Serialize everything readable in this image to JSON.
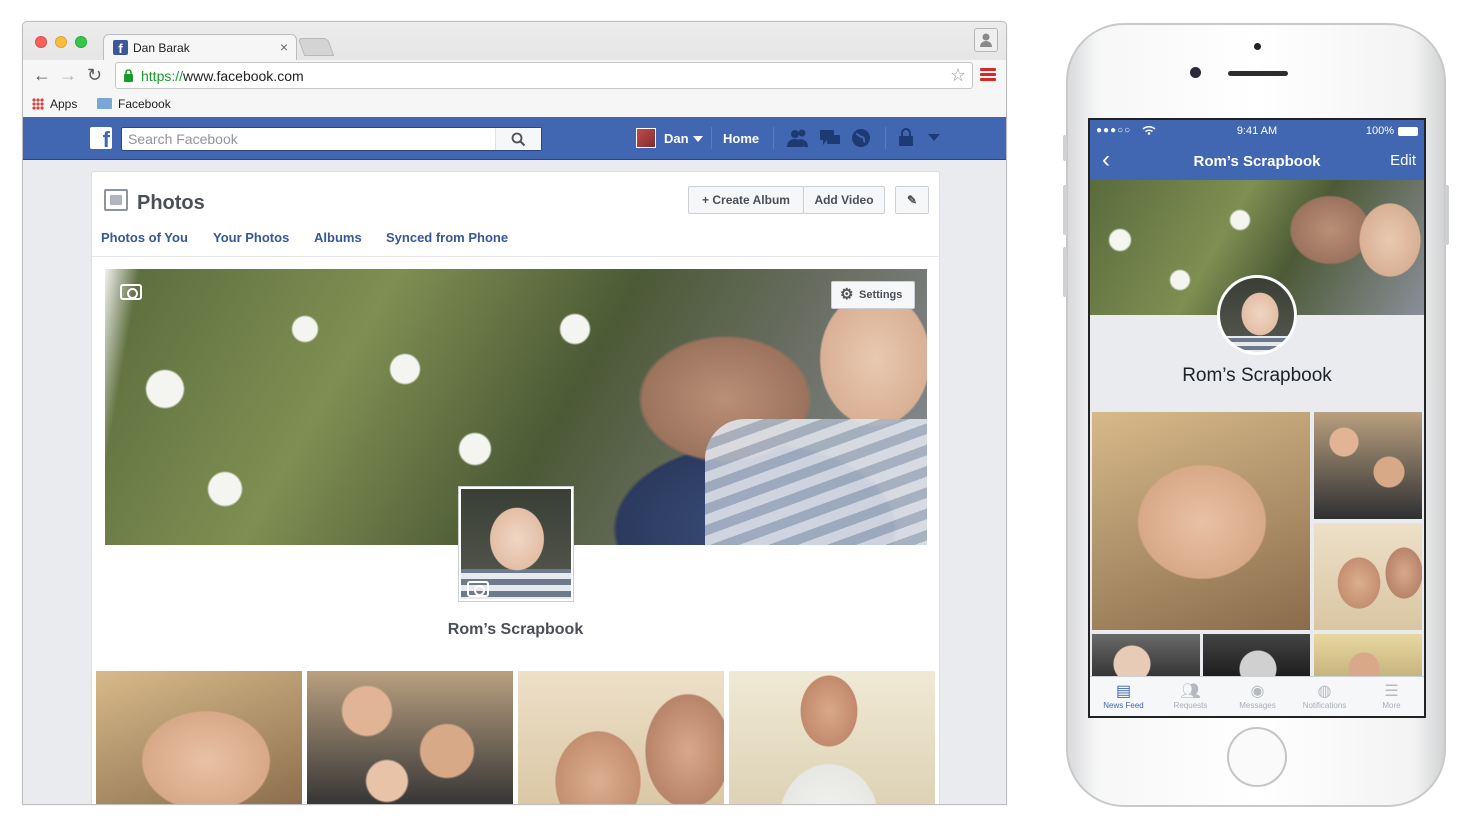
{
  "browser": {
    "tab_title": "Dan Barak",
    "tab_close": "×",
    "url_scheme": "https://",
    "url_host": "www.facebook.com",
    "bookmarks": [
      {
        "label": "Apps",
        "icon": "apps-grid-icon"
      },
      {
        "label": "Facebook",
        "icon": "folder-icon"
      }
    ]
  },
  "fb": {
    "search_placeholder": "Search Facebook",
    "user_name": "Dan",
    "home_label": "Home"
  },
  "photos": {
    "title": "Photos",
    "create_album": "+ Create Album",
    "add_video": "Add Video",
    "subnav": [
      "Photos of You",
      "Your Photos",
      "Albums",
      "Synced from Phone"
    ],
    "settings_label": "Settings",
    "album_name": "Rom’s Scrapbook"
  },
  "phone": {
    "signal": "●●●○○",
    "time": "9:41 AM",
    "battery": "100%",
    "title": "Rom’s Scrapbook",
    "edit": "Edit",
    "album_name": "Rom’s Scrapbook",
    "tabs": [
      {
        "label": "News Feed",
        "icon": "news-feed-icon",
        "active": true
      },
      {
        "label": "Requests",
        "icon": "requests-icon",
        "active": false
      },
      {
        "label": "Messages",
        "icon": "messages-icon",
        "active": false
      },
      {
        "label": "Notifications",
        "icon": "notifications-icon",
        "active": false
      },
      {
        "label": "More",
        "icon": "more-icon",
        "active": false
      }
    ]
  },
  "colors": {
    "facebook_blue": "#4267b2",
    "link_blue": "#365899",
    "https_green": "#1a9c2a"
  }
}
